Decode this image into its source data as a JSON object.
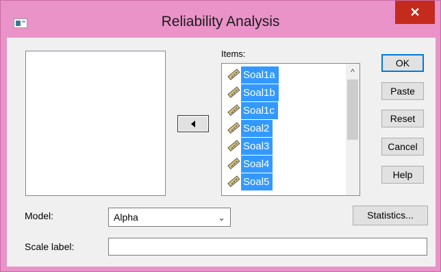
{
  "window": {
    "title": "Reliability Analysis",
    "close_glyph": "✕"
  },
  "variables_list": [],
  "move_button": {
    "icon": "arrow-left-icon"
  },
  "items": {
    "label": "Items:",
    "entries": [
      {
        "label": "Soal1a",
        "selected": true
      },
      {
        "label": "Soal1b",
        "selected": true
      },
      {
        "label": "Soal1c",
        "selected": true
      },
      {
        "label": "Soal2",
        "selected": true
      },
      {
        "label": "Soal3",
        "selected": true
      },
      {
        "label": "Soal4",
        "selected": true
      },
      {
        "label": "Soal5",
        "selected": true
      }
    ],
    "scroll_up_glyph": "^"
  },
  "buttons": {
    "ok": "OK",
    "paste": "Paste",
    "reset": "Reset",
    "cancel": "Cancel",
    "help": "Help",
    "statistics": "Statistics..."
  },
  "model": {
    "label": "Model:",
    "value": "Alpha",
    "chevron": "⌄"
  },
  "scale": {
    "label": "Scale label:",
    "value": ""
  },
  "colors": {
    "title_bar": "#e993c9",
    "close": "#c42b1c",
    "selection": "#3399ff"
  }
}
